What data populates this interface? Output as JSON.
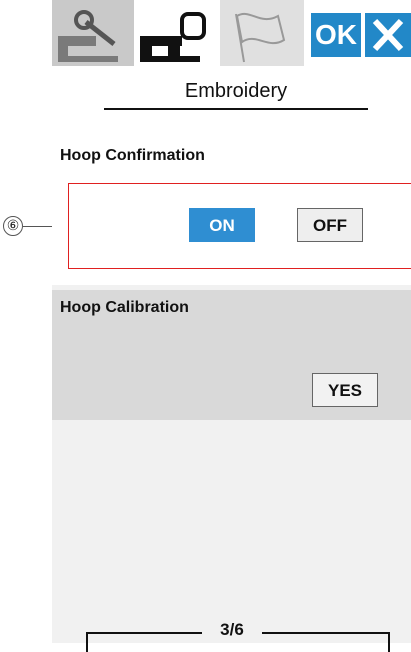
{
  "callout": {
    "number": "⑥"
  },
  "toolbar": {
    "ok_label": "OK"
  },
  "header": {
    "title": "Embroidery"
  },
  "hoop_confirmation": {
    "label": "Hoop Confirmation",
    "on_label": "ON",
    "off_label": "OFF",
    "selected": "ON"
  },
  "hoop_calibration": {
    "label": "Hoop Calibration",
    "yes_label": "YES"
  },
  "pagination": {
    "page": "3/6"
  },
  "colors": {
    "accent": "#2288c8",
    "highlight_border": "#e02020"
  }
}
